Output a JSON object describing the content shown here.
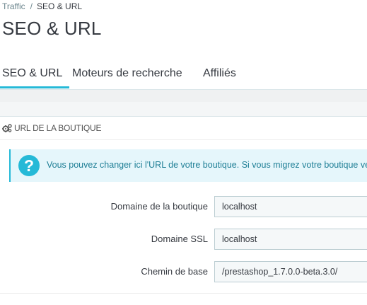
{
  "breadcrumb": {
    "parent": "Traffic",
    "separator": "/",
    "current": "SEO & URL"
  },
  "page_title": "SEO & URL",
  "tabs": [
    {
      "label": "SEO & URL",
      "active": true
    },
    {
      "label": "Moteurs de recherche",
      "active": false
    },
    {
      "label": "Affiliés",
      "active": false
    }
  ],
  "panel": {
    "heading": "URL DE LA BOUTIQUE",
    "heading_icon": "cogs-icon",
    "alert": {
      "icon": "question-icon",
      "icon_glyph": "?",
      "text": "Vous pouvez changer ici l'URL de votre boutique. Si vous migrez votre boutique ve"
    },
    "fields": [
      {
        "label": "Domaine de la boutique",
        "value": "localhost"
      },
      {
        "label": "Domaine SSL",
        "value": "localhost"
      },
      {
        "label": "Chemin de base",
        "value": "/prestashop_1.7.0.0-beta.3.0/"
      }
    ]
  },
  "colors": {
    "accent": "#25b9d7",
    "alert_bg": "#e5f6fb",
    "alert_text": "#1f7f96",
    "input_bg": "#f5f8f9",
    "input_border": "#bbcdd2",
    "band_bg": "#eff1f2"
  }
}
